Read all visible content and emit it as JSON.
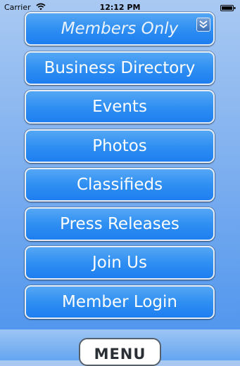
{
  "status_bar": {
    "carrier": "Carrier",
    "time": "12:12 PM",
    "wifi_icon": "wifi-icon",
    "battery_icon": "battery-icon"
  },
  "menu": {
    "members_only": "Members Only",
    "collapse_icon": "double-chevron-down-icon",
    "items": [
      {
        "label": "Business Directory"
      },
      {
        "label": "Events"
      },
      {
        "label": "Photos"
      },
      {
        "label": "Classifieds"
      },
      {
        "label": "Press Releases"
      },
      {
        "label": "Join Us"
      },
      {
        "label": "Member Login"
      }
    ]
  },
  "bottom": {
    "menu_label": "MENU"
  },
  "colors": {
    "button_blue": "#2f8ff2",
    "background_top": "#a9c9f2",
    "background_bottom": "#4a92ee"
  }
}
